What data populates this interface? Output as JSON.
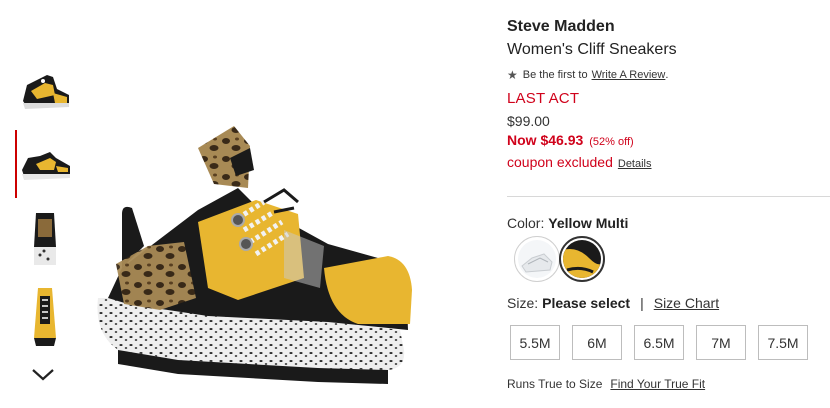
{
  "product": {
    "brand": "Steve Madden",
    "name": "Women's Cliff Sneakers",
    "rating_prefix": "Be the first to",
    "review_link": "Write A Review",
    "rating_suffix": ".",
    "badge": "LAST ACT",
    "original_price": "$99.00",
    "sale_price": "Now $46.93",
    "discount": "(52% off)",
    "coupon_text": "coupon excluded",
    "coupon_details": "Details"
  },
  "color": {
    "label": "Color:",
    "selected": "Yellow Multi",
    "swatches": [
      "white-swatch",
      "yellow-multi-swatch"
    ]
  },
  "size": {
    "label": "Size:",
    "selected": "Please select",
    "separator": "|",
    "chart_link": "Size Chart",
    "options": [
      "5.5M",
      "6M",
      "6.5M",
      "7M",
      "7.5M"
    ]
  },
  "fit": {
    "label": "Runs True to Size",
    "link": "Find Your True Fit"
  },
  "colors": {
    "accent_red": "#d0021b",
    "yellow": "#e8b630",
    "black": "#1a1a1a"
  }
}
